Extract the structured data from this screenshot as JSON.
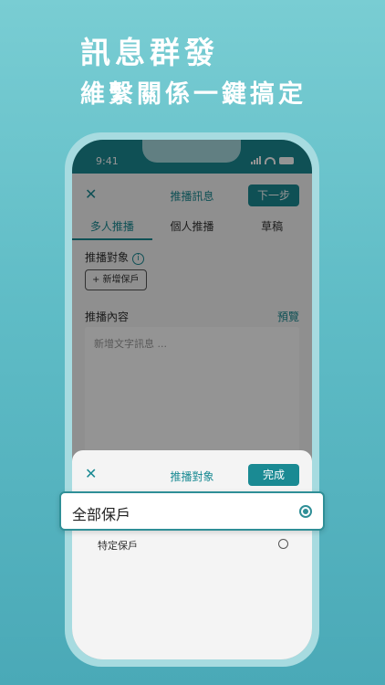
{
  "headline": {
    "line1": "訊息群發",
    "line2": "維繫關係一鍵搞定"
  },
  "status_bar": {
    "time": "9:41"
  },
  "nav": {
    "close_icon": "✕",
    "title": "推播訊息",
    "next_label": "下一步"
  },
  "tabs": [
    {
      "label": "多人推播",
      "active": true
    },
    {
      "label": "個人推播",
      "active": false
    },
    {
      "label": "草稿",
      "active": false
    }
  ],
  "form": {
    "target_label": "推播對象",
    "info_icon": "i",
    "add_button_label": "+ 新增保戶",
    "content_label": "推播內容",
    "preview_label": "預覽",
    "message_placeholder": "新增文字訊息 ..."
  },
  "sheet": {
    "close_icon": "✕",
    "title": "推播對象",
    "done_label": "完成",
    "options": [
      {
        "label": "全部保戶",
        "selected": true
      },
      {
        "label": "特定保戶",
        "selected": false
      }
    ]
  },
  "colors": {
    "accent": "#1a8a93",
    "background_top": "#79cdd3",
    "background_bottom": "#4aa9b7"
  }
}
